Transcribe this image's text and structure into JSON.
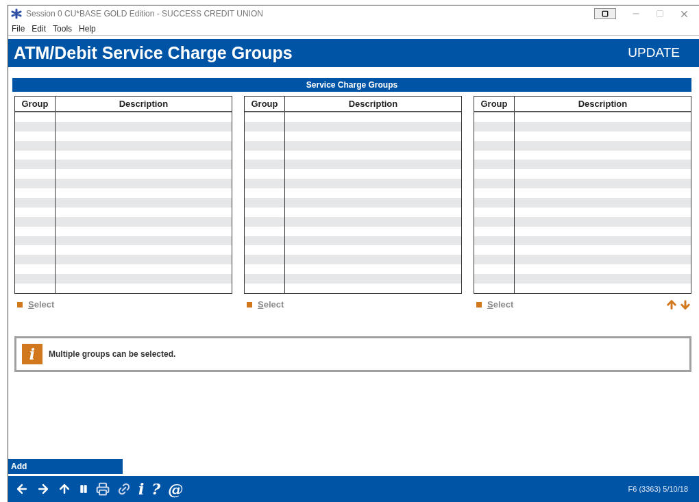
{
  "window": {
    "title": "Session 0 CU*BASE GOLD Edition - SUCCESS CREDIT UNION"
  },
  "menu": [
    "File",
    "Edit",
    "Tools",
    "Help"
  ],
  "header": {
    "title": "ATM/Debit Service Charge Groups",
    "mode": "UPDATE"
  },
  "section": {
    "title": "Service Charge Groups"
  },
  "tables": [
    {
      "columns": [
        "Group",
        "Description"
      ],
      "action": "Select"
    },
    {
      "columns": [
        "Group",
        "Description"
      ],
      "action": "Select"
    },
    {
      "columns": [
        "Group",
        "Description"
      ],
      "action": "Select"
    }
  ],
  "info": {
    "icon": "i",
    "message": "Multiple groups can be selected."
  },
  "function_keys": [
    "Add"
  ],
  "toolbar": [
    {
      "kind": "back"
    },
    {
      "kind": "forward"
    },
    {
      "kind": "up"
    },
    {
      "kind": "pause"
    },
    {
      "kind": "print"
    },
    {
      "kind": "link"
    },
    {
      "kind": "glyph",
      "text": "i"
    },
    {
      "kind": "glyph",
      "text": "?"
    },
    {
      "kind": "glyph",
      "text": "@"
    }
  ],
  "status": "F6 (3363) 5/10/18"
}
